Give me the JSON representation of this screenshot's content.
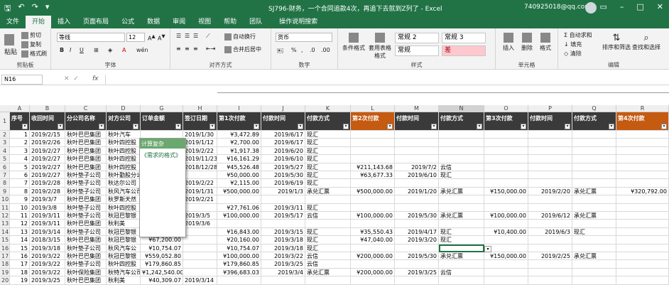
{
  "titlebar": {
    "title": "SJ796-财务，一个合同追款4次，再追下去就到Z列了 - Excel",
    "account": "740925018@qq.com"
  },
  "tabs": [
    "文件",
    "开始",
    "插入",
    "页面布局",
    "公式",
    "数据",
    "审阅",
    "视图",
    "帮助",
    "团队",
    "操作说明搜索"
  ],
  "active_tab": "开始",
  "ribbon": {
    "clipboard": {
      "paste": "粘贴",
      "cut": "剪切",
      "copy": "复制",
      "format_painter": "格式刷",
      "group": "剪贴板"
    },
    "font": {
      "name": "等线",
      "size": "12",
      "group": "字体"
    },
    "alignment": {
      "wrap": "自动换行",
      "merge": "合并后居中",
      "group": "对齐方式"
    },
    "number": {
      "format": "货币",
      "group": "数字"
    },
    "styles": {
      "cond": "条件格式",
      "table": "套用表格格式",
      "normal2": "常规 2",
      "normal3": "常规 3",
      "normal": "常规",
      "bad": "差",
      "group": "样式"
    },
    "cells": {
      "insert": "插入",
      "delete": "删除",
      "format": "格式",
      "group": "单元格"
    },
    "editing": {
      "autosum": "自动求和",
      "fill": "填充",
      "clear": "清除",
      "sort": "排序和筛选",
      "find": "查找和选择",
      "group": "编辑"
    }
  },
  "namebox": "N16",
  "fx": "fx",
  "columns": [
    "A",
    "B",
    "C",
    "D",
    "G",
    "H",
    "I",
    "J",
    "K",
    "L",
    "M",
    "N",
    "O",
    "P",
    "Q",
    "R"
  ],
  "headers": [
    "序号",
    "收回时间",
    "分公司名称",
    "对方公司",
    "订单金额",
    "签订日期",
    "第1次付款",
    "付款时间",
    "付款方式",
    "第2次付款",
    "付款时间",
    "付款方式",
    "第3次付款",
    "付款时间",
    "付款方式",
    "第4次付款"
  ],
  "popup": {
    "title": "计算复杂",
    "body": "《需求的格式》"
  },
  "rows": [
    [
      "1",
      "2019/2/15",
      "秋叶巴巴集团",
      "秋叶汽车",
      "",
      "2019/1/30",
      "¥3,472.89",
      "2019/6/17",
      "现汇",
      "",
      "",
      "",
      "",
      "",
      "",
      ""
    ],
    [
      "2",
      "2019/2/26",
      "秋叶巴巴集团",
      "秋叶四控股",
      "",
      "2019/1/12",
      "¥2,700.00",
      "2019/6/17",
      "现汇",
      "",
      "",
      "",
      "",
      "",
      "",
      ""
    ],
    [
      "3",
      "2019/2/27",
      "秋叶巴巴集团",
      "秋叶四控股",
      "",
      "2019/2/22",
      "¥1,917.38",
      "2019/6/20",
      "现汇",
      "",
      "",
      "",
      "",
      "",
      "",
      ""
    ],
    [
      "4",
      "2019/2/27",
      "秋叶巴巴集团",
      "秋叶四控股",
      "",
      "2019/11/23",
      "¥16,161.29",
      "2019/6/10",
      "现汇",
      "",
      "",
      "",
      "",
      "",
      "",
      ""
    ],
    [
      "5",
      "2019/2/27",
      "秋叶巴巴集团",
      "秋叶四控股",
      "",
      "2018/12/28",
      "¥45,526.48",
      "2019/5/27",
      "现汇",
      "¥211,143.68",
      "2019/7/2",
      "云信",
      "",
      "",
      "",
      ""
    ],
    [
      "6",
      "2019/2/27",
      "秋叶垫子公司",
      "秋叶勤股分公",
      "",
      "",
      "¥50,000.00",
      "2019/5/30",
      "现汇",
      "¥63,677.33",
      "2019/6/10",
      "现汇",
      "",
      "",
      "",
      ""
    ],
    [
      "7",
      "2019/2/28",
      "秋叶垫子公司",
      "秋达尔公司",
      "",
      "2019/2/22",
      "¥2,115.00",
      "2019/6/19",
      "现汇",
      "",
      "",
      "",
      "",
      "",
      "",
      ""
    ],
    [
      "8",
      "2019/2/28",
      "秋叶垫子公司",
      "秋风汽车公司",
      "",
      "2019/1/31",
      "¥500,000.00",
      "2019/1/3",
      "承兑汇票",
      "¥500,000.00",
      "2019/1/20",
      "承兑汇票",
      "¥150,000.00",
      "2019/2/20",
      "承兑汇票",
      "¥320,792.00"
    ],
    [
      "9",
      "2019/3/7",
      "秋叶巴巴集团",
      "秋罗斯天然",
      "¥1,461,600.00",
      "2019/2/21",
      "",
      "",
      "",
      "",
      "",
      "",
      "",
      "",
      "",
      ""
    ],
    [
      "10",
      "2019/3/8",
      "秋叶垫子公司",
      "秋叶四控股",
      "¥27,761.06",
      "",
      "¥27,761.06",
      "2019/3/11",
      "现汇",
      "",
      "",
      "",
      "",
      "",
      "",
      ""
    ],
    [
      "11",
      "2019/3/11",
      "秋叶垫子公司",
      "秋冠巴黎银",
      "¥412,245.00",
      "2019/3/5",
      "¥100,000.00",
      "2019/5/17",
      "云信",
      "¥100,000.00",
      "2019/5/30",
      "承兑汇票",
      "¥100,000.00",
      "2019/6/12",
      "承兑汇票",
      ""
    ],
    [
      "12",
      "2019/3/11",
      "秋叶巴巴集团",
      "秋利美",
      "¥14,167.78",
      "2019/3/6",
      "",
      "",
      "",
      "",
      "",
      "",
      "",
      "",
      "",
      ""
    ],
    [
      "13",
      "2019/3/14",
      "秋叶垫子公司",
      "秋冠巴黎银",
      "¥56,145.00",
      "",
      "¥16,843.00",
      "2019/3/15",
      "现汇",
      "¥35,550.43",
      "2019/4/17",
      "现汇",
      "¥10,400.00",
      "2019/6/3",
      "现汇",
      ""
    ],
    [
      "14",
      "2018/3/15",
      "秋叶巴巴集团",
      "秋冠巴黎银",
      "¥67,200.00",
      "",
      "¥20,160.00",
      "2019/3/18",
      "现汇",
      "¥47,040.00",
      "2019/3/20",
      "现汇",
      "",
      "",
      "",
      ""
    ],
    [
      "15",
      "2019/3/18",
      "秋叶垫子公司",
      "秋风汽车公",
      "¥10,754.07",
      "",
      "¥10,754.07",
      "2019/3/18",
      "现汇",
      "",
      "",
      "",
      "",
      "",
      "",
      ""
    ],
    [
      "16",
      "2019/3/22",
      "秋叶巴巴集团",
      "秋冠巴黎银",
      "¥559,052.80",
      "",
      "¥100,000.00",
      "2019/3/22",
      "云信",
      "¥200,000.00",
      "2019/5/30",
      "承兑汇票",
      "¥150,000.00",
      "2019/2/25",
      "承兑汇票",
      ""
    ],
    [
      "17",
      "2019/3/22",
      "秋叶垫子公司",
      "秋叶四控股",
      "¥179,860.85",
      "",
      "¥179,860.85",
      "2019/3/25",
      "云信",
      "",
      "",
      "",
      "",
      "",
      "",
      ""
    ],
    [
      "18",
      "2019/3/22",
      "秋叶保险集团",
      "秋特汽车公司",
      "¥1,242,540.00",
      "",
      "¥396,683.03",
      "2019/3/4",
      "承兑汇票",
      "¥200,000.00",
      "2019/3/25",
      "云信",
      "",
      "",
      "",
      ""
    ],
    [
      "19",
      "2019/3/25",
      "秋叶巴巴集团",
      "秋利美",
      "¥40,309.07",
      "2019/3/14",
      "",
      "",
      "",
      "",
      "",
      "",
      "",
      "",
      "",
      ""
    ]
  ],
  "colors": {
    "excel_green": "#217346",
    "dark_header": "#3a3a3a",
    "orange_header": "#c55a11",
    "popup_green": "#6aa86e"
  }
}
